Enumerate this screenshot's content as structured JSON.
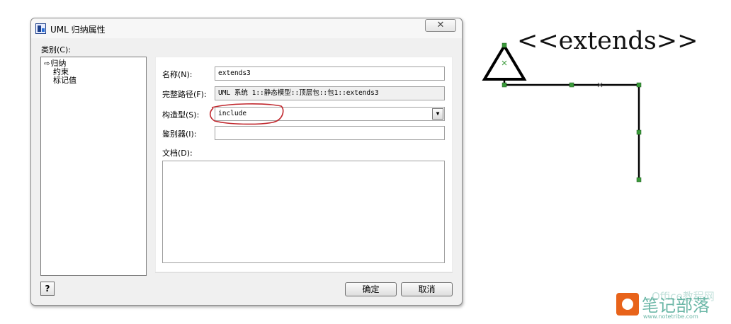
{
  "dialog": {
    "title": "UML 归纳属性",
    "close_label": "✕",
    "category_label": "类别(C):",
    "categories": [
      {
        "label": "归纳",
        "selected": true
      },
      {
        "label": "约束",
        "selected": false
      },
      {
        "label": "标记值",
        "selected": false
      }
    ],
    "fields": {
      "name_label": "名称(N):",
      "name_value": "extends3",
      "path_label": "完整路径(F):",
      "path_value": "UML 系统 1::静态模型::顶层包::包1::extends3",
      "stereotype_label": "构造型(S):",
      "stereotype_value": "include",
      "discriminator_label": "鉴别器(I):",
      "discriminator_value": "",
      "doc_label": "文档(D):",
      "doc_value": ""
    },
    "help_label": "?",
    "ok_label": "确定",
    "cancel_label": "取消"
  },
  "diagram": {
    "stereotype_text": "<<extends>>",
    "line_color": "#000000",
    "handle_color": "#3a9a3a"
  },
  "watermark": {
    "main": "笔记部落",
    "sub": "www.notetribe.com",
    "faint": "Office教程网"
  },
  "colors": {
    "annotation_red": "#c0272d",
    "dialog_bg": "#f0f0f0",
    "watermark": "#3c9f8a",
    "watermark_logo": "#e8631a"
  }
}
